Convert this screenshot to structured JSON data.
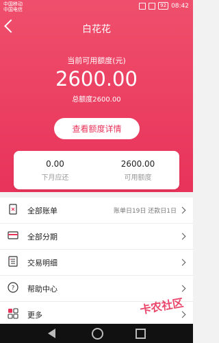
{
  "status_bar": {
    "carrier1": "中国移动",
    "carrier2": "中国电信",
    "time": "08:42",
    "battery": "92"
  },
  "header": {
    "title": "白花花"
  },
  "hero": {
    "available_label": "当前可用额度(元)",
    "available_amount": "2600.00",
    "total_limit": "总额度2600.00",
    "detail_button": "查看额度详情"
  },
  "summary": {
    "due_value": "0.00",
    "due_label": "下月应还",
    "available_value": "2600.00",
    "available_label": "可用额度"
  },
  "menu": {
    "items": [
      {
        "label": "全部账单",
        "note": "账单日19日 还款日1日",
        "icon": "bill-icon"
      },
      {
        "label": "全部分期",
        "note": "",
        "icon": "card-icon"
      },
      {
        "label": "交易明细",
        "note": "",
        "icon": "list-icon"
      },
      {
        "label": "帮助中心",
        "note": "",
        "icon": "help-icon"
      },
      {
        "label": "更多",
        "note": "",
        "icon": "more-icon"
      }
    ]
  },
  "watermark": "卡农社区",
  "colors": {
    "primary": "#e8335a"
  }
}
